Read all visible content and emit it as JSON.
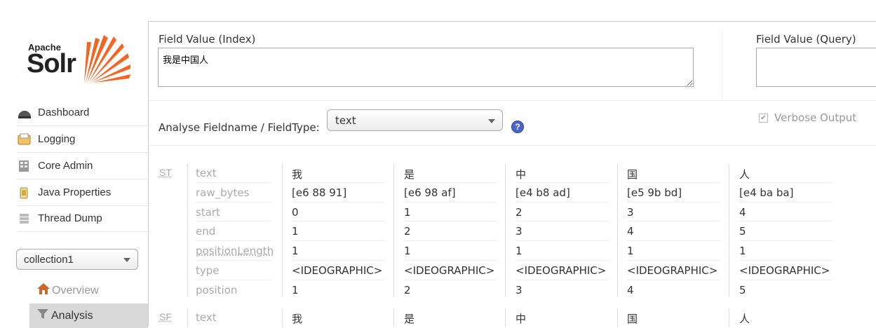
{
  "logo": {
    "top": "Apache",
    "name": "Solr"
  },
  "nav": [
    {
      "label": "Dashboard",
      "icon": "dashboard-icon"
    },
    {
      "label": "Logging",
      "icon": "logging-icon"
    },
    {
      "label": "Core Admin",
      "icon": "core-admin-icon"
    },
    {
      "label": "Java Properties",
      "icon": "java-properties-icon"
    },
    {
      "label": "Thread Dump",
      "icon": "thread-dump-icon"
    }
  ],
  "core_selector": {
    "value": "collection1"
  },
  "core_menu": [
    {
      "label": "Overview",
      "icon": "home-icon"
    },
    {
      "label": "Analysis",
      "icon": "funnel-icon"
    }
  ],
  "analysis": {
    "index_label": "Field Value (Index)",
    "index_value": "我是中国人",
    "query_label": "Field Value (Query)",
    "query_value": "",
    "fieldtype_label": "Analyse Fieldname / FieldType:",
    "fieldtype_value": "text",
    "help": "?",
    "verbose_label": "Verbose Output",
    "verbose_checked": true
  },
  "stages": [
    {
      "name": "ST",
      "attributes": [
        "text",
        "raw_bytes",
        "start",
        "end",
        "positionLength",
        "type",
        "position"
      ],
      "tokens": [
        [
          "我",
          "[e6 88 91]",
          "0",
          "1",
          "1",
          "<IDEOGRAPHIC>",
          "1"
        ],
        [
          "是",
          "[e6 98 af]",
          "1",
          "2",
          "1",
          "<IDEOGRAPHIC>",
          "2"
        ],
        [
          "中",
          "[e4 b8 ad]",
          "2",
          "3",
          "1",
          "<IDEOGRAPHIC>",
          "3"
        ],
        [
          "国",
          "[e5 9b bd]",
          "3",
          "4",
          "1",
          "<IDEOGRAPHIC>",
          "4"
        ],
        [
          "人",
          "[e4 ba ba]",
          "4",
          "5",
          "1",
          "<IDEOGRAPHIC>",
          "5"
        ]
      ]
    },
    {
      "name": "SF",
      "attributes": [
        "text"
      ],
      "tokens": [
        [
          "我"
        ],
        [
          "是"
        ],
        [
          "中"
        ],
        [
          "国"
        ],
        [
          "人"
        ]
      ]
    }
  ]
}
